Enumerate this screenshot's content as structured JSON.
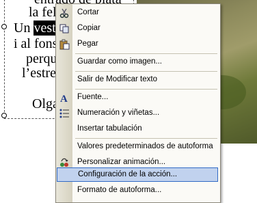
{
  "slide": {
    "lines": [
      "entrado de plata",
      "la feli",
      "Un",
      "vest",
      "i al fons",
      "perqu",
      "l’estre",
      "Olga"
    ]
  },
  "context_menu": {
    "items": [
      {
        "label": "Cortar",
        "icon": "scissors-icon"
      },
      {
        "label": "Copiar",
        "icon": "copy-icon"
      },
      {
        "label": "Pegar",
        "icon": "paste-icon"
      },
      {
        "label": "Guardar como imagen..."
      },
      {
        "label": "Salir de Modificar texto"
      },
      {
        "label": "Fuente...",
        "icon": "font-icon"
      },
      {
        "label": "Numeración y viñetas...",
        "icon": "bullets-icon"
      },
      {
        "label": "Insertar tabulación"
      },
      {
        "label": "Valores predeterminados de autoforma"
      },
      {
        "label": "Personalizar animación...",
        "icon": "animation-icon"
      },
      {
        "label": "Configuración de la acción..."
      },
      {
        "label": "Formato de autoforma..."
      }
    ],
    "selected_index": 10
  },
  "colors": {
    "highlight_fill": "#c1d2ee",
    "highlight_border": "#316ac5",
    "menu_background": "#fbfaf6"
  }
}
